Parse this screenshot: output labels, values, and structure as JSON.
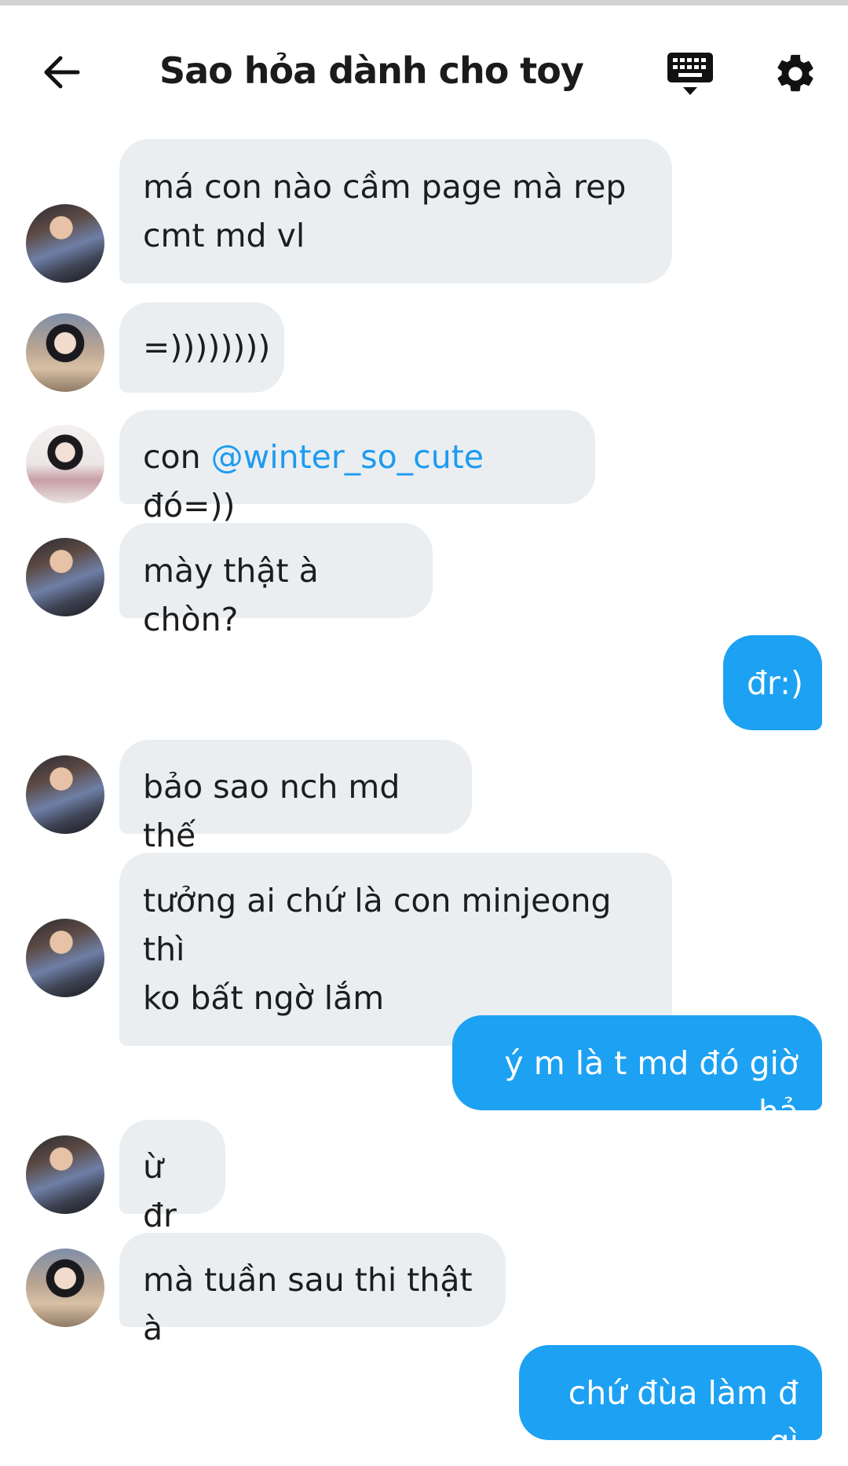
{
  "header": {
    "title": "Sao hỏa dành cho toy",
    "back_icon": "back-arrow-icon",
    "keyboard_icon": "keyboard-icon",
    "settings_icon": "gear-icon"
  },
  "colors": {
    "outgoing_bubble": "#1da1f2",
    "incoming_bubble": "#ebeef1",
    "mention": "#1d9bf0"
  },
  "messages": [
    {
      "direction": "in",
      "text": "má con nào cầm page mà rep\ncmt md vl"
    },
    {
      "direction": "in",
      "text": "=))))))))"
    },
    {
      "direction": "in",
      "text_before": "con ",
      "mention": "@winter_so_cute",
      "text_after": " đó=))"
    },
    {
      "direction": "in",
      "text": "mày thật à chòn?"
    },
    {
      "direction": "out",
      "text": "đr:)"
    },
    {
      "direction": "in",
      "text": "bảo sao nch md thế"
    },
    {
      "direction": "in",
      "text": "tưởng ai chứ là con minjeong thì\nko bất ngờ lắm"
    },
    {
      "direction": "out",
      "text": "ý m là t md đó giờ hả"
    },
    {
      "direction": "in",
      "text": "ừ đr"
    },
    {
      "direction": "in",
      "text": "mà tuần sau thi thật à"
    },
    {
      "direction": "out",
      "text": "chứ đùa làm đ gì"
    }
  ]
}
